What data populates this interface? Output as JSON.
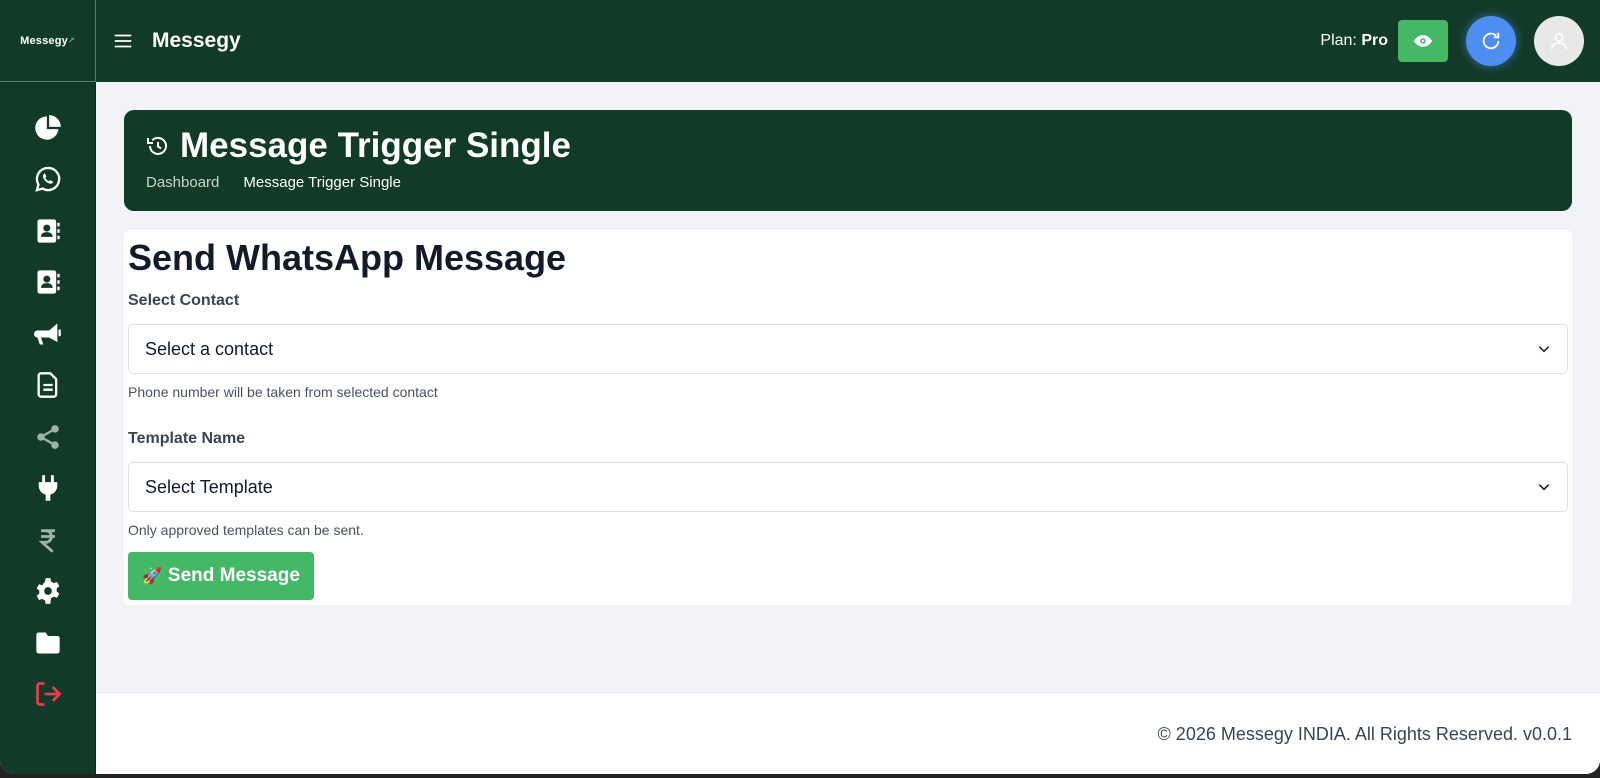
{
  "app": {
    "logo_text": "Messegy",
    "brand": "Messegy"
  },
  "header": {
    "plan_label": "Plan:",
    "plan_value": "Pro"
  },
  "sidebar": {
    "items": [
      {
        "icon": "pie-chart-icon"
      },
      {
        "icon": "whatsapp-icon"
      },
      {
        "icon": "contact-book-icon"
      },
      {
        "icon": "contact-book-icon"
      },
      {
        "icon": "megaphone-icon"
      },
      {
        "icon": "document-icon"
      },
      {
        "icon": "share-icon"
      },
      {
        "icon": "plug-icon"
      },
      {
        "icon": "rupee-icon"
      },
      {
        "icon": "gear-icon"
      },
      {
        "icon": "folder-icon"
      },
      {
        "icon": "logout-icon"
      }
    ],
    "logout_color": "#e0404a"
  },
  "page_header": {
    "title": "Message Trigger Single",
    "breadcrumb": [
      "Dashboard",
      "Message Trigger Single"
    ]
  },
  "form": {
    "title": "Send WhatsApp Message",
    "contact_label": "Select Contact",
    "contact_selected": "Select a contact",
    "contact_help": "Phone number will be taken from selected contact",
    "template_label": "Template Name",
    "template_selected": "Select Template",
    "template_help": "Only approved templates can be sent.",
    "send_label": "Send Message",
    "send_icon": "🚀"
  },
  "footer": {
    "text": "© 2026 Messegy INDIA. All Rights Reserved. v0.0.1"
  },
  "colors": {
    "primary_dark": "#113a28",
    "accent_green": "#45b866",
    "refresh_blue": "#4e8ef2"
  }
}
